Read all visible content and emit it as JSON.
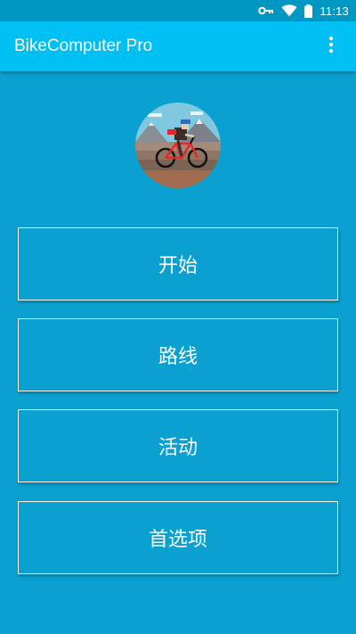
{
  "status_bar": {
    "time": "11:13",
    "icons": [
      "vpn-key-icon",
      "wifi-icon",
      "battery-icon"
    ]
  },
  "app_bar": {
    "title": "BikeComputer Pro",
    "overflow_icon": "more-vert-icon"
  },
  "avatar": {
    "icon": "cyclist-avatar-icon"
  },
  "menu": {
    "items": [
      {
        "label": "开始"
      },
      {
        "label": "路线"
      },
      {
        "label": "活动"
      },
      {
        "label": "首选项"
      }
    ]
  },
  "colors": {
    "background": "#0aa0cf",
    "status_bar": "#0097c3",
    "app_bar": "#00bff3",
    "text": "#ffffff"
  }
}
